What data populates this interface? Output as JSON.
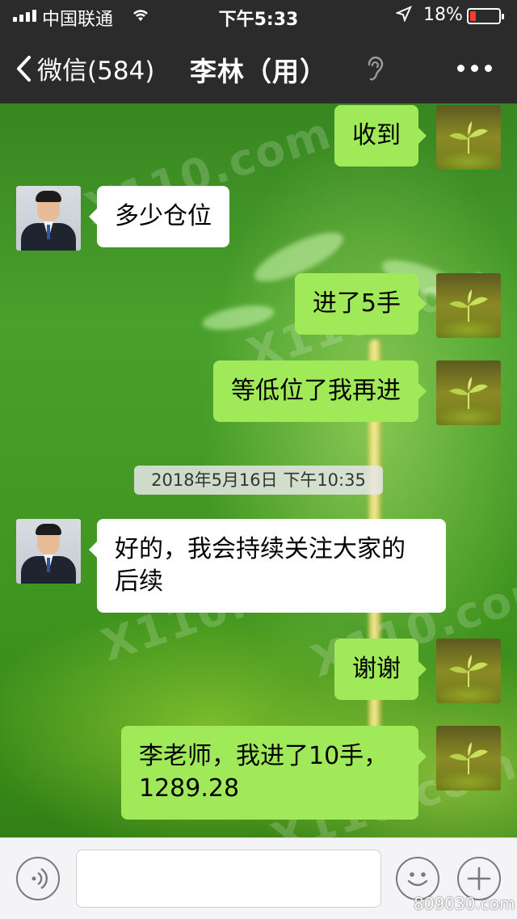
{
  "status_bar": {
    "carrier": "中国联通",
    "time": "下午5:33",
    "battery_percent": "18%"
  },
  "nav": {
    "back_label": "微信(584)",
    "title": "李林（用）"
  },
  "messages": [
    {
      "from": "me",
      "text": "收到"
    },
    {
      "from": "teacher",
      "text": "多少仓位"
    },
    {
      "from": "me",
      "text": "进了5手"
    },
    {
      "from": "me",
      "text": "等低位了我再进"
    },
    {
      "from": "teacher",
      "text": "好的，我会持续关注大家的后续"
    },
    {
      "from": "me",
      "text": "谢谢"
    },
    {
      "from": "me",
      "text": "李老师，我进了10手，1289.28"
    }
  ],
  "timestamp": "2018年5月16日 下午10:35",
  "watermark_corner": "809030.com",
  "background_watermark": "X110.com",
  "colors": {
    "sent_bubble": "#a0e959",
    "received_bubble": "#ffffff",
    "nav_bg": "#2b2b2b",
    "battery_low": "#ff3b30"
  },
  "icons": {
    "back": "chevron-left-icon",
    "ear": "ear-icon",
    "more": "more-dots-icon",
    "voice": "voice-icon",
    "emoji": "emoji-icon",
    "plus": "plus-icon"
  }
}
